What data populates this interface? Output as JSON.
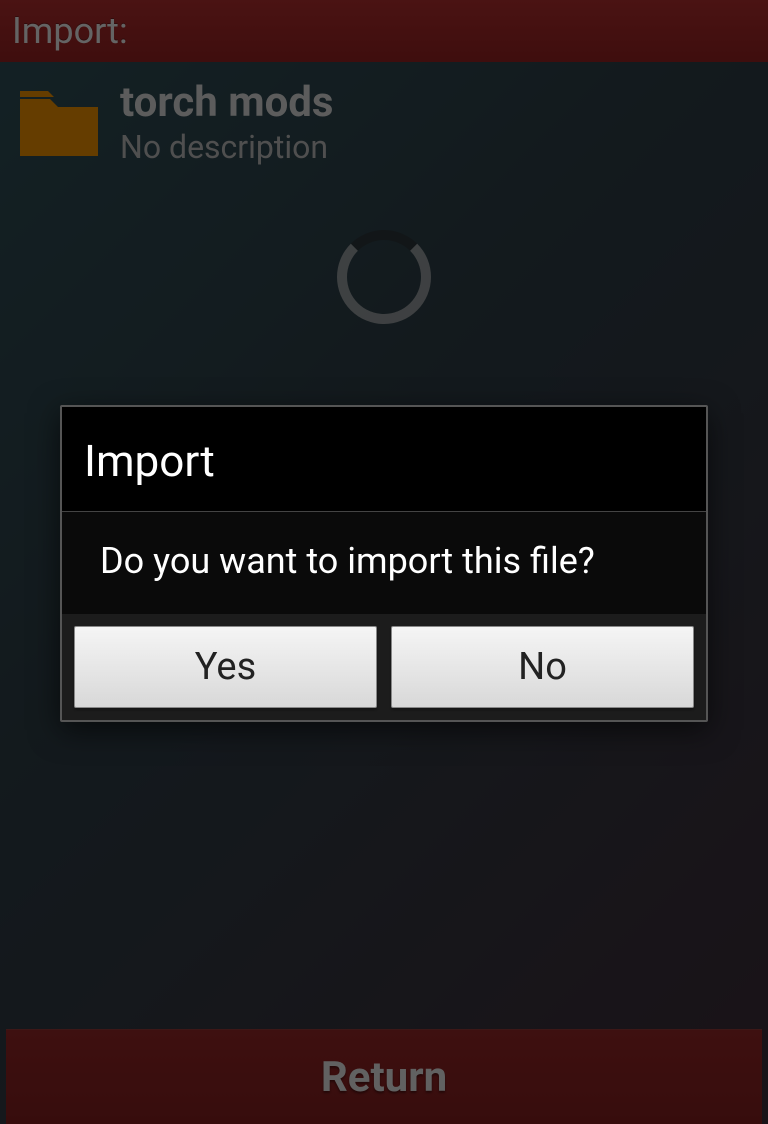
{
  "header": {
    "title": "Import:"
  },
  "list": {
    "items": [
      {
        "title": "torch mods",
        "subtitle": "No description",
        "icon": "folder"
      }
    ]
  },
  "bottom": {
    "return_label": "Return"
  },
  "dialog": {
    "title": "Import",
    "message": "Do you want to import this file?",
    "yes_label": "Yes",
    "no_label": "No"
  },
  "colors": {
    "accent": "#a52a2a",
    "folder": "#e08800"
  }
}
